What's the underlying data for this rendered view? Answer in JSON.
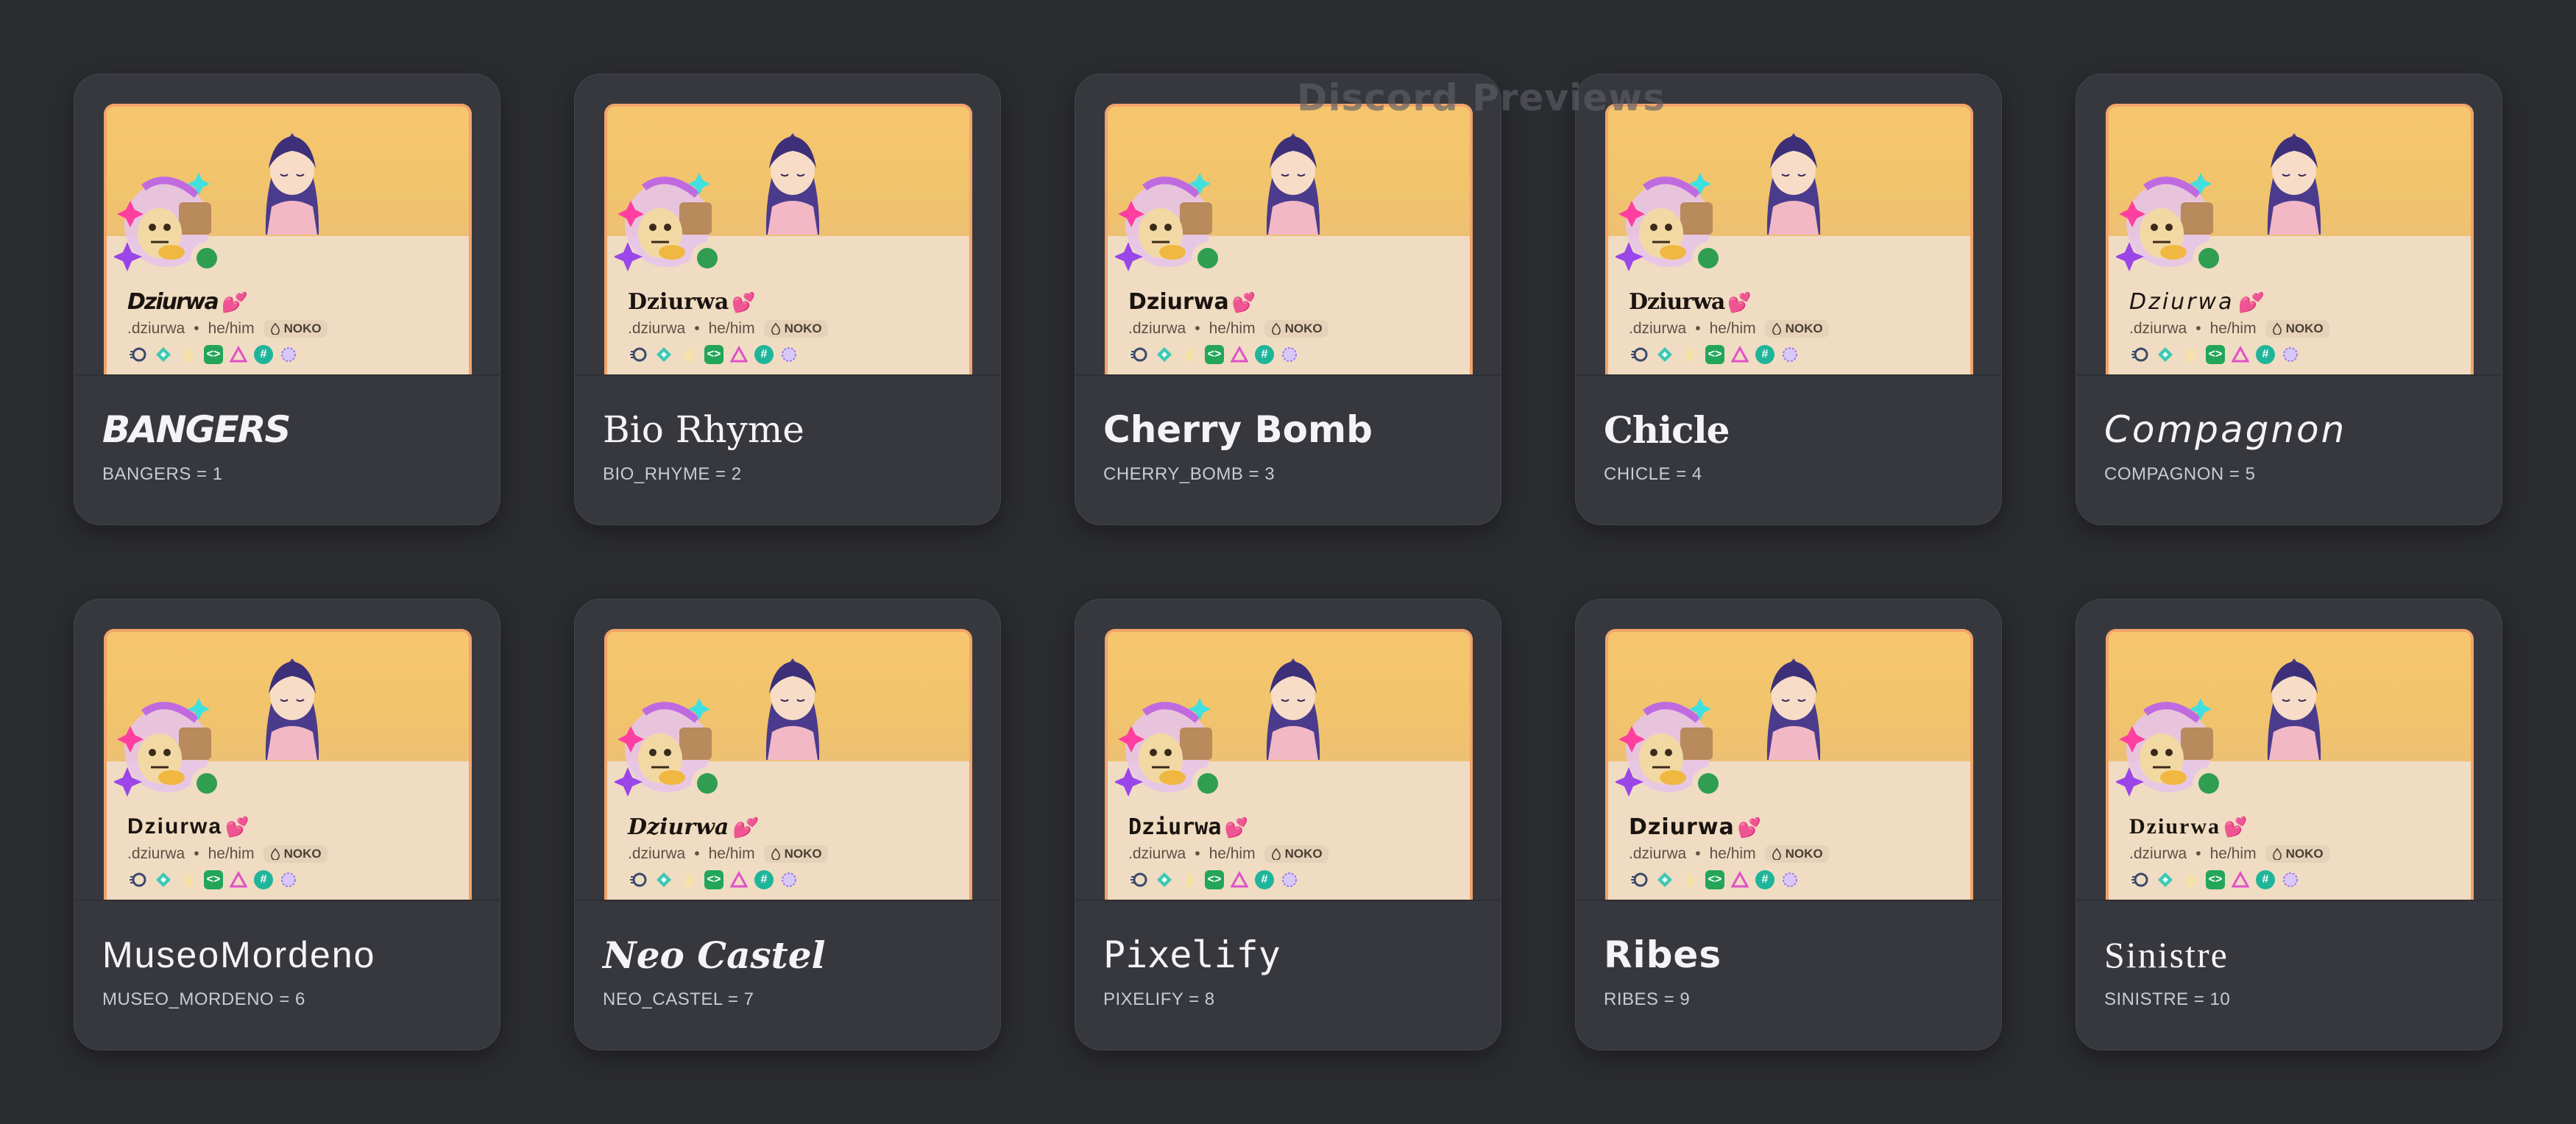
{
  "watermark": "Discord Previews",
  "profile": {
    "display_name": "Dziurwa",
    "heart": "💕",
    "username": ".dziurwa",
    "separator": "•",
    "pronouns": "he/him",
    "tag": "NOKO"
  },
  "fonts": [
    {
      "name": "BANGERS",
      "code": "BANGERS = 1",
      "style": "f-bangers"
    },
    {
      "name": "Bio Rhyme",
      "code": "BIO_RHYME = 2",
      "style": "f-bio"
    },
    {
      "name": "Cherry Bomb",
      "code": "CHERRY_BOMB = 3",
      "style": "f-cherry"
    },
    {
      "name": "Chicle",
      "code": "CHICLE = 4",
      "style": "f-chicle"
    },
    {
      "name": "Compagnon",
      "code": "COMPAGNON = 5",
      "style": "f-comp"
    },
    {
      "name": "MuseoMordeno",
      "code": "MUSEO_MORDENO = 6",
      "style": "f-museo"
    },
    {
      "name": "Neo Castel",
      "code": "NEO_CASTEL = 7",
      "style": "f-neo"
    },
    {
      "name": "Pixelify",
      "code": "PIXELIFY = 8",
      "style": "f-pixel"
    },
    {
      "name": "Ribes",
      "code": "RIBES = 9",
      "style": "f-ribes"
    },
    {
      "name": "Sinistre",
      "code": "SINISTRE = 10",
      "style": "f-sinistre"
    }
  ],
  "colors": {
    "background": "#2b2c30",
    "card": "#37383e",
    "banner": "#f6c66e",
    "profile_bg": "#f0dcc2",
    "frame": "#f2a46a",
    "online": "#2f9e50"
  },
  "badge_icons": [
    "speed-badge-icon",
    "gem-badge-icon",
    "hand-badge-icon",
    "code-badge-icon",
    "triangle-badge-icon",
    "hash-badge-icon",
    "nitro-badge-icon"
  ]
}
